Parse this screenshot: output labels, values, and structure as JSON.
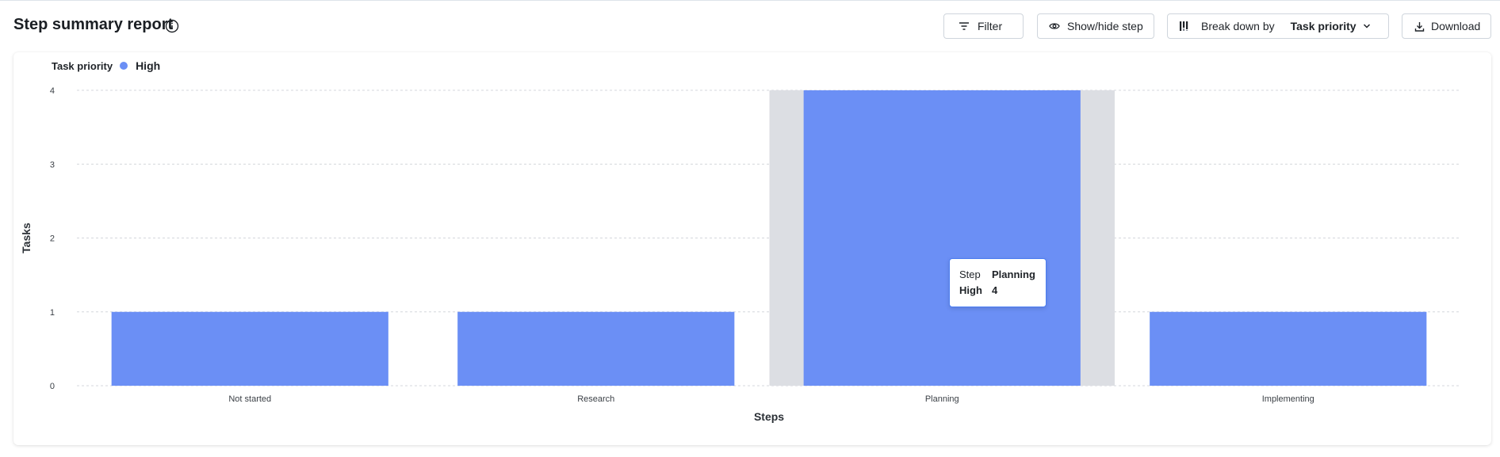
{
  "header": {
    "title": "Step summary report",
    "filter_label": "Filter",
    "show_hide_label": "Show/hide step",
    "break_down_label": "Break down by",
    "break_down_value": "Task priority",
    "download_label": "Download"
  },
  "legend": {
    "title": "Task priority",
    "items": [
      {
        "name": "High",
        "color": "#6b8ff5"
      }
    ]
  },
  "tooltip": {
    "step_label": "Step",
    "step_value": "Planning",
    "series_label": "High",
    "series_value": "4"
  },
  "colors": {
    "bar": "#6b8ff5",
    "hover_band": "#dcdee3",
    "grid": "#d4d7dc",
    "tooltip_border": "#4a7df2"
  },
  "chart_data": {
    "type": "bar",
    "categories": [
      "Not started",
      "Research",
      "Planning",
      "Implementing"
    ],
    "series": [
      {
        "name": "High",
        "values": [
          1,
          1,
          4,
          1
        ]
      }
    ],
    "xlabel": "Steps",
    "ylabel": "Tasks",
    "ylim": [
      0,
      4
    ],
    "yticks": [
      0,
      1,
      2,
      3,
      4
    ],
    "grid": true,
    "legend_position": "top-left",
    "highlighted_category": "Planning"
  }
}
